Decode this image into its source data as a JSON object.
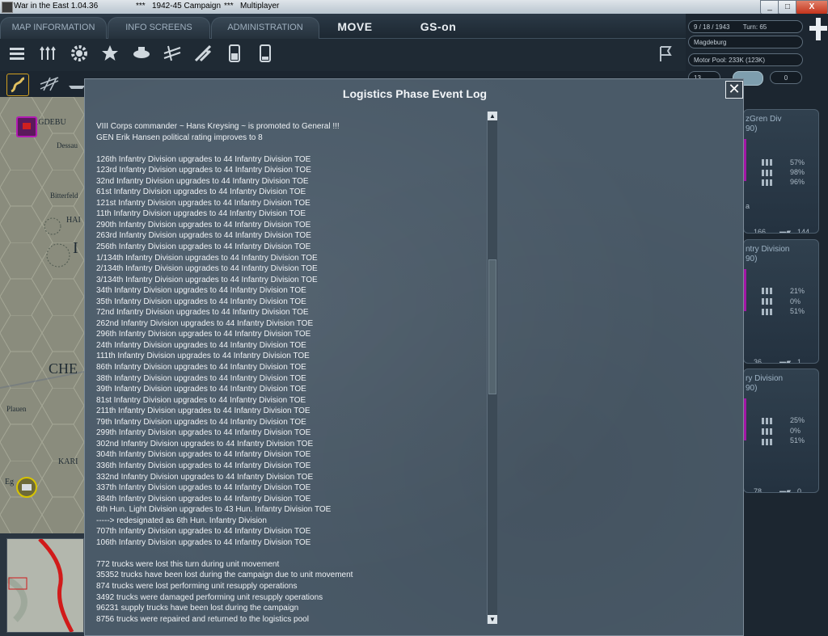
{
  "titlebar": {
    "app_title": "War in the East 1.04.36",
    "sep1": "***",
    "campaign": "1942-45 Campaign",
    "sep2": "***",
    "mode": "Multiplayer",
    "min_label": "_",
    "max_label": "□",
    "close_label": "X"
  },
  "menu": {
    "tabs": [
      "MAP INFORMATION",
      "INFO SCREENS",
      "ADMINISTRATION"
    ],
    "move_label": "MOVE",
    "gs_label": "GS-on"
  },
  "info": {
    "date": "9 / 18 / 1943",
    "turn": "Turn: 65",
    "location": "Magdeburg",
    "motor_pool": "Motor Pool: 233K (123K)",
    "counter_left": "13",
    "counter_right": "0"
  },
  "map": {
    "labels": [
      "AGDEBU",
      "Dessau",
      "Bitterfeld",
      "HAI",
      "I",
      "CHE",
      "Plauen",
      "KARI",
      "Eg"
    ]
  },
  "cards": [
    {
      "title": "zGren Div",
      "subtitle": "90)",
      "p1": "57%",
      "p2": "98%",
      "p3": "96%",
      "extra": "a",
      "left": "166",
      "right": "144"
    },
    {
      "title": "ntry Division",
      "subtitle": "90)",
      "p1": "21%",
      "p2": "0%",
      "p3": "51%",
      "extra": "",
      "left": "36",
      "right": "1"
    },
    {
      "title": "ry Division",
      "subtitle": "90)",
      "p1": "25%",
      "p2": "0%",
      "p3": "51%",
      "extra": "",
      "left": "78",
      "right": "0"
    }
  ],
  "dialog": {
    "title": "Logistics Phase Event Log",
    "close_label": "✕",
    "lines": [
      "VIII Corps commander ~ Hans Kreysing ~ is promoted to General !!!",
      "GEN Erik Hansen political rating improves to 8",
      "",
      "126th Infantry Division upgrades to 44 Infantry Division TOE",
      "123rd Infantry Division upgrades to 44 Infantry Division TOE",
      "32nd Infantry Division upgrades to 44 Infantry Division TOE",
      "61st Infantry Division upgrades to 44 Infantry Division TOE",
      "121st Infantry Division upgrades to 44 Infantry Division TOE",
      "11th Infantry Division upgrades to 44 Infantry Division TOE",
      "290th Infantry Division upgrades to 44 Infantry Division TOE",
      "263rd Infantry Division upgrades to 44 Infantry Division TOE",
      "256th Infantry Division upgrades to 44 Infantry Division TOE",
      "1/134th Infantry Division upgrades to 44 Infantry Division TOE",
      "2/134th Infantry Division upgrades to 44 Infantry Division TOE",
      "3/134th Infantry Division upgrades to 44 Infantry Division TOE",
      "34th Infantry Division upgrades to 44 Infantry Division TOE",
      "35th Infantry Division upgrades to 44 Infantry Division TOE",
      "72nd Infantry Division upgrades to 44 Infantry Division TOE",
      "262nd Infantry Division upgrades to 44 Infantry Division TOE",
      "296th Infantry Division upgrades to 44 Infantry Division TOE",
      "24th Infantry Division upgrades to 44 Infantry Division TOE",
      "111th Infantry Division upgrades to 44 Infantry Division TOE",
      "86th Infantry Division upgrades to 44 Infantry Division TOE",
      "38th Infantry Division upgrades to 44 Infantry Division TOE",
      "39th Infantry Division upgrades to 44 Infantry Division TOE",
      "81st Infantry Division upgrades to 44 Infantry Division TOE",
      "211th Infantry Division upgrades to 44 Infantry Division TOE",
      "79th Infantry Division upgrades to 44 Infantry Division TOE",
      "299th Infantry Division upgrades to 44 Infantry Division TOE",
      "302nd Infantry Division upgrades to 44 Infantry Division TOE",
      "304th Infantry Division upgrades to 44 Infantry Division TOE",
      "336th Infantry Division upgrades to 44 Infantry Division TOE",
      "332nd Infantry Division upgrades to 44 Infantry Division TOE",
      "337th Infantry Division upgrades to 44 Infantry Division TOE",
      "384th Infantry Division upgrades to 44 Infantry Division TOE",
      "6th Hun. Light Division upgrades to 43 Hun. Infantry Division TOE",
      "-----> redesignated as 6th Hun. Infantry Division",
      "707th Infantry Division upgrades to 44 Infantry Division TOE",
      "106th Infantry Division upgrades to 44 Infantry Division TOE",
      "",
      "772 trucks were lost this turn during unit movement",
      "35352 trucks have been lost during the campaign due to unit movement",
      "874 trucks were lost performing unit resupply operations",
      "3492 trucks were damaged performing unit resupply operations",
      "96231 supply trucks have been lost during the campaign",
      "8756 trucks were repaired and returned to the logistics pool"
    ],
    "scroll_up": "▲",
    "scroll_down": "▼"
  },
  "colors": {
    "unit_magenta": "#b21bb3",
    "unit_yellow": "#d8c400",
    "front_line": "#d11a1a"
  }
}
